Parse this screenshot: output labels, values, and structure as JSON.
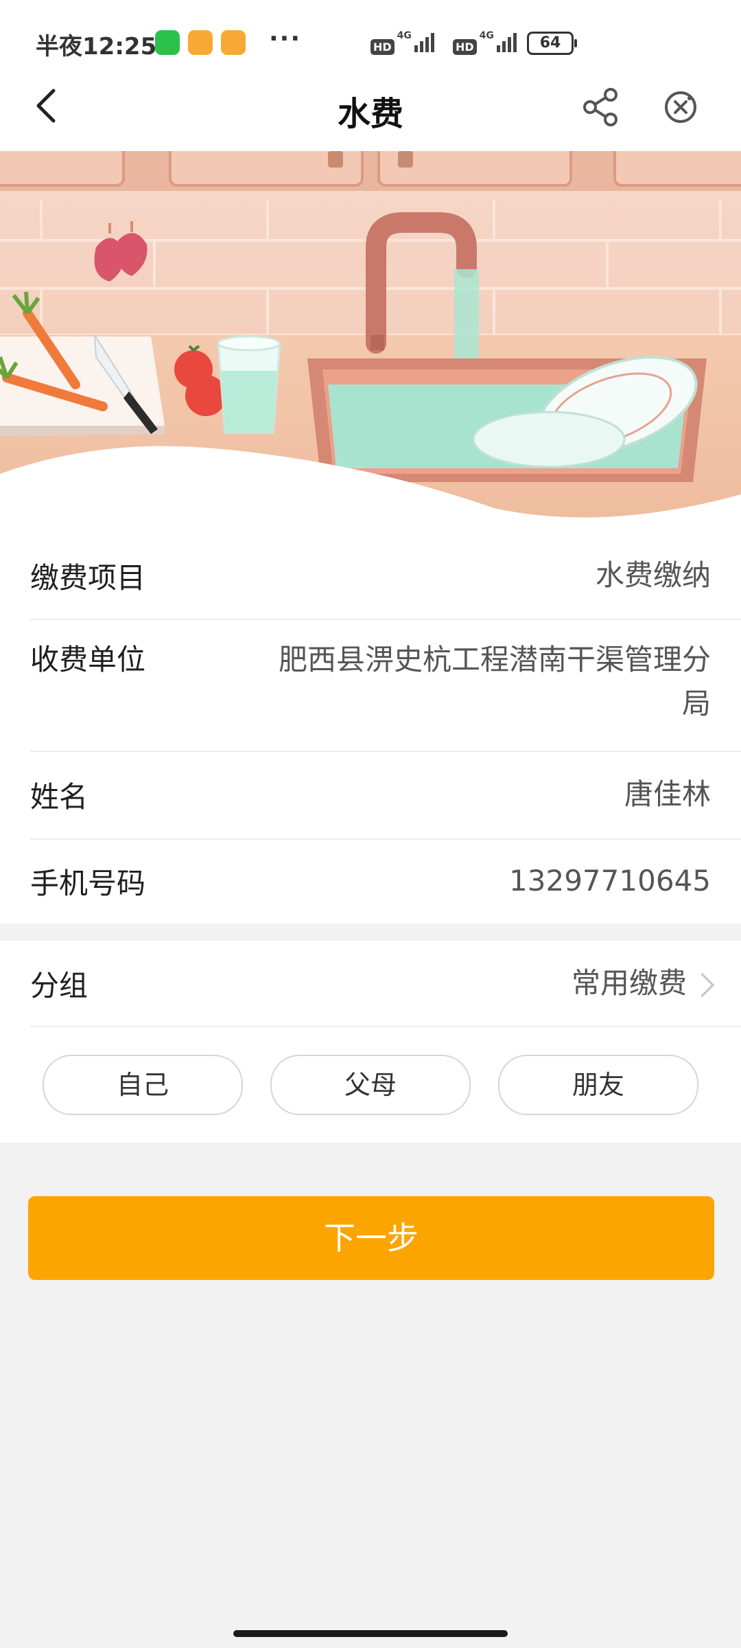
{
  "status_bar": {
    "time": "半夜12:25",
    "more": "···",
    "hd1": "HD",
    "hd2": "HD",
    "net1": "4G",
    "net2": "4G",
    "battery": "64"
  },
  "nav": {
    "title": "水费"
  },
  "info": {
    "rows": [
      {
        "label": "缴费项目",
        "value": "水费缴纳"
      },
      {
        "label": "收费单位",
        "value": "肥西县淠史杭工程潜南干渠管理分局"
      },
      {
        "label": "姓名",
        "value": "唐佳林"
      },
      {
        "label": "手机号码",
        "value": "13297710645"
      }
    ]
  },
  "group": {
    "label": "分组",
    "value": "常用缴费",
    "chips": [
      "自己",
      "父母",
      "朋友"
    ]
  },
  "actions": {
    "next": "下一步"
  },
  "colors": {
    "accent": "#fca500"
  }
}
